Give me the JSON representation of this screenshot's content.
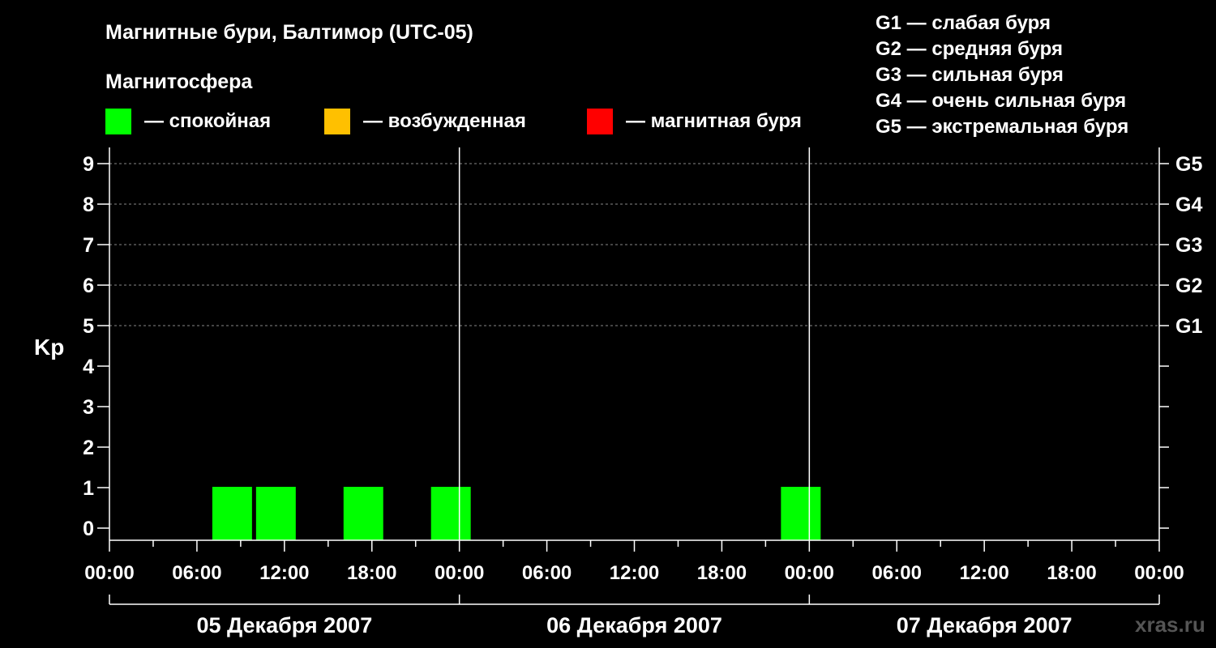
{
  "title": "Магнитные бури, Балтимор (UTC-05)",
  "legend": {
    "heading": "Магнитосфера",
    "items": [
      {
        "label": "— спокойная",
        "color": "#00ff00"
      },
      {
        "label": "— возбужденная",
        "color": "#ffc000"
      },
      {
        "label": "— магнитная буря",
        "color": "#ff0000"
      }
    ]
  },
  "g_scale": [
    "G1 — слабая буря",
    "G2 — средняя буря",
    "G3 — сильная буря",
    "G4 — очень сильная буря",
    "G5 — экстремальная буря"
  ],
  "watermark": "xras.ru",
  "chart_data": {
    "type": "bar",
    "ylabel": "Kp",
    "ylim": [
      0,
      9
    ],
    "y_ticks": [
      "0",
      "1",
      "2",
      "3",
      "4",
      "5",
      "6",
      "7",
      "8",
      "9"
    ],
    "g_ticks": [
      {
        "kp": 5,
        "label": "G1"
      },
      {
        "kp": 6,
        "label": "G2"
      },
      {
        "kp": 7,
        "label": "G3"
      },
      {
        "kp": 8,
        "label": "G4"
      },
      {
        "kp": 9,
        "label": "G5"
      }
    ],
    "x_hours_range": [
      0,
      72
    ],
    "x_tick_labels": [
      "00:00",
      "06:00",
      "12:00",
      "18:00",
      "00:00",
      "06:00",
      "12:00",
      "18:00",
      "00:00",
      "06:00",
      "12:00",
      "18:00",
      "00:00"
    ],
    "dates": [
      "05 Декабря 2007",
      "06 Декабря 2007",
      "07 Декабря 2007"
    ],
    "grid": true,
    "bars": [
      {
        "start_hour": 7,
        "end_hour": 10,
        "kp": 1,
        "status": "спокойная",
        "color": "#00ff00"
      },
      {
        "start_hour": 10,
        "end_hour": 13,
        "kp": 1,
        "status": "спокойная",
        "color": "#00ff00"
      },
      {
        "start_hour": 16,
        "end_hour": 19,
        "kp": 1,
        "status": "спокойная",
        "color": "#00ff00"
      },
      {
        "start_hour": 22,
        "end_hour": 25,
        "kp": 1,
        "status": "спокойная",
        "color": "#00ff00"
      },
      {
        "start_hour": 46,
        "end_hour": 49,
        "kp": 1,
        "status": "спокойная",
        "color": "#00ff00"
      }
    ]
  }
}
